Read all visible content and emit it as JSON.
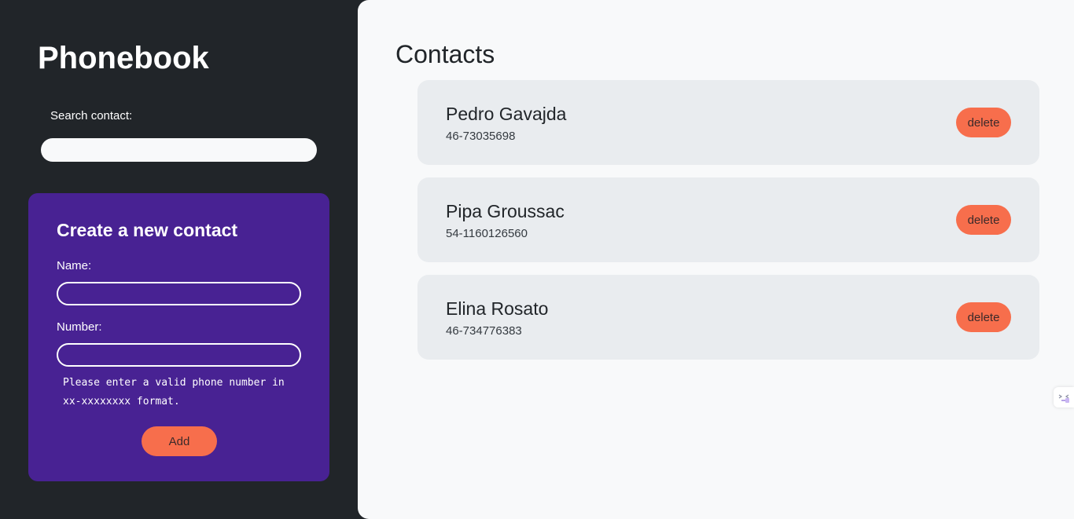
{
  "app": {
    "title": "Phonebook"
  },
  "search": {
    "label": "Search contact:",
    "value": ""
  },
  "form": {
    "title": "Create a new contact",
    "name_label": "Name:",
    "name_value": "",
    "number_label": "Number:",
    "number_value": "",
    "hint": "Please enter a valid phone number in xx-xxxxxxxx format.",
    "add_label": "Add"
  },
  "contacts": {
    "title": "Contacts",
    "items": [
      {
        "name": "Pedro Gavajda",
        "number": "46-73035698",
        "delete_label": "delete"
      },
      {
        "name": "Pipa Groussac",
        "number": "54-1160126560",
        "delete_label": "delete"
      },
      {
        "name": "Elina Rosato",
        "number": "46-734776383",
        "delete_label": "delete"
      }
    ]
  },
  "widget": {
    "icon": "extension-icon"
  },
  "colors": {
    "sidebar_bg": "#212529",
    "form_bg": "#482293",
    "main_bg": "#f8f9fa",
    "card_bg": "#e9ecef",
    "accent": "#f76e4c"
  }
}
